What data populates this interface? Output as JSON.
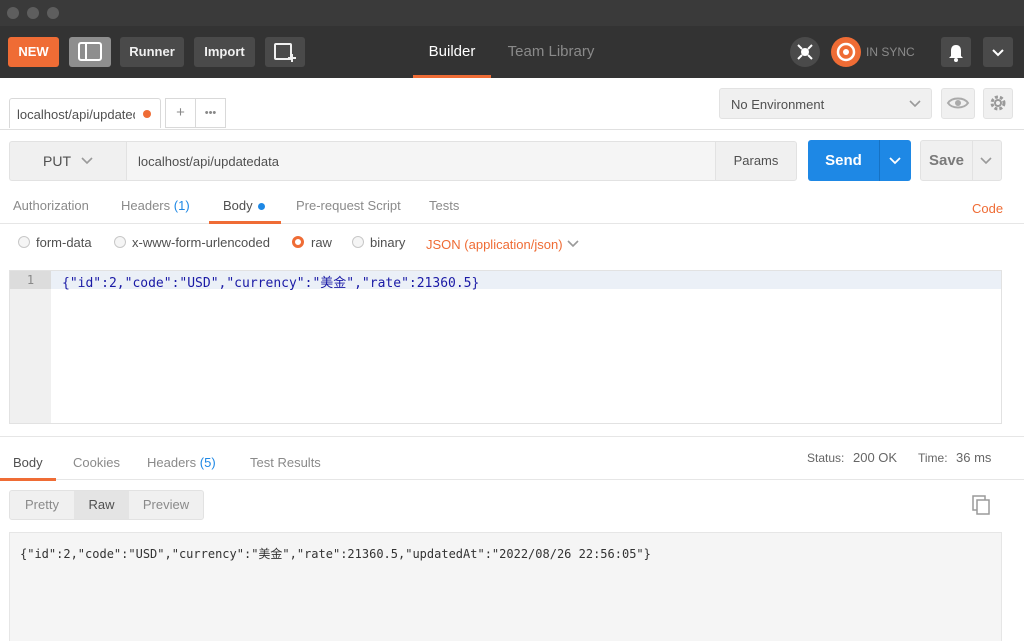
{
  "header": {
    "new_label": "NEW",
    "runner_label": "Runner",
    "import_label": "Import",
    "tabs": [
      {
        "label": "Builder"
      },
      {
        "label": "Team Library"
      }
    ],
    "sync_status": "IN SYNC"
  },
  "request_tab": {
    "label": "localhost/api/updatedata",
    "add_label": "+",
    "more_label": "•••"
  },
  "environment": {
    "selected": "No Environment"
  },
  "request": {
    "method": "PUT",
    "url": "localhost/api/updatedata",
    "params_label": "Params",
    "send_label": "Send",
    "save_label": "Save"
  },
  "request_tabs": {
    "authorization": "Authorization",
    "headers": "Headers",
    "headers_count": "(1)",
    "body": "Body",
    "pre_request": "Pre-request Script",
    "tests": "Tests",
    "code": "Code"
  },
  "body_types": {
    "form_data": "form-data",
    "urlencoded": "x-www-form-urlencoded",
    "raw": "raw",
    "binary": "binary",
    "format": "JSON (application/json)"
  },
  "editor": {
    "line_number": "1",
    "content": "{\"id\":2,\"code\":\"USD\",\"currency\":\"美金\",\"rate\":21360.5}"
  },
  "response_tabs": {
    "body": "Body",
    "cookies": "Cookies",
    "headers": "Headers",
    "headers_count": "(5)",
    "test_results": "Test Results"
  },
  "response_status": {
    "status_label": "Status:",
    "status_value": "200 OK",
    "time_label": "Time:",
    "time_value": "36 ms"
  },
  "response_view": {
    "pretty": "Pretty",
    "raw": "Raw",
    "preview": "Preview"
  },
  "response_body": "{\"id\":2,\"code\":\"USD\",\"currency\":\"美金\",\"rate\":21360.5,\"updatedAt\":\"2022/08/26 22:56:05\"}"
}
